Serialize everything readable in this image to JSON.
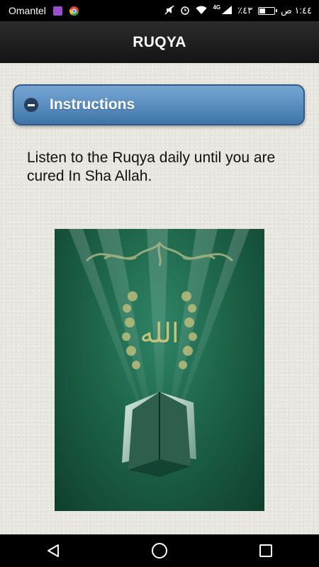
{
  "status_bar": {
    "carrier": "Omantel",
    "right_text": "٪٤٣",
    "time": "١:٤٤ ص",
    "network": "4G",
    "battery_level": 0.43
  },
  "app_bar": {
    "title": "RUQYA"
  },
  "instructions": {
    "title": "Instructions",
    "body": "Listen to the Ruqya daily until you are cured In Sha Allah.",
    "expanded": true,
    "header_color": "#5d91c2"
  },
  "image": {
    "subject": "Quran book on green background with Allah calligraphy",
    "calligraphy": "الله"
  },
  "nav_bar": {
    "buttons": [
      "back",
      "home",
      "recents"
    ]
  }
}
